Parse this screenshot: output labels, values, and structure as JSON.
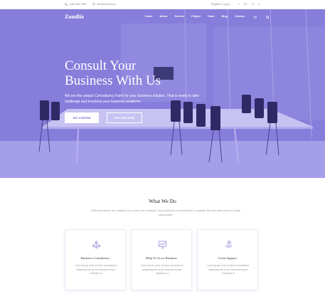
{
  "topbar": {
    "phone": "(+88) 524 1566",
    "email": "info@zomo.com",
    "auth": "Register / Log in",
    "social": [
      "f",
      "G+",
      "in",
      "p"
    ]
  },
  "nav": {
    "logo": "ZomBiz",
    "items": [
      "Home",
      "About",
      "Service",
      "Project",
      "Team",
      "Blog",
      "Contact"
    ]
  },
  "hero": {
    "title_line1": "Consult Your",
    "title_line2": "Business With Us",
    "subtitle": "We are the unique Consultancy Farm for your business solution, That is ready to take challenge and knockout your business problems.",
    "btn_started": "GET STARTED",
    "btn_explore": "EXPLORE MORE"
  },
  "whatwedo": {
    "title": "What We Do",
    "description": "Rafbe'ztos lobortis nisi ut adipisci ac mi cursi nune consequat. Duis porta dolor in reprehenderit in voluptate velit esse cillum dolore eu fugiat nulla pariatur."
  },
  "cards": [
    {
      "title": "Business Consultancy",
      "text": "Lorem ipsum dolor sit amet consectetuor adipiscing elit sed do eiusmod tempor incididunt ut",
      "icon": "team-network-icon"
    },
    {
      "title": "Help To Grow Business",
      "text": "Lorem ipsum dolor sit amet consectetuor adipiscing elit sed do eiusmod tempor incididunt ut",
      "icon": "growth-chart-icon"
    },
    {
      "title": "Great Support",
      "text": "Lorem ipsum dolor sit amet consectetuor adipiscing elit sed do eiusmod tempor incididunt ut",
      "icon": "support-hand-icon"
    }
  ],
  "colors": {
    "accent": "#7e74d6",
    "hero_overlay": "#8a81dc",
    "text_dark": "#222222",
    "text_muted": "#999999"
  }
}
